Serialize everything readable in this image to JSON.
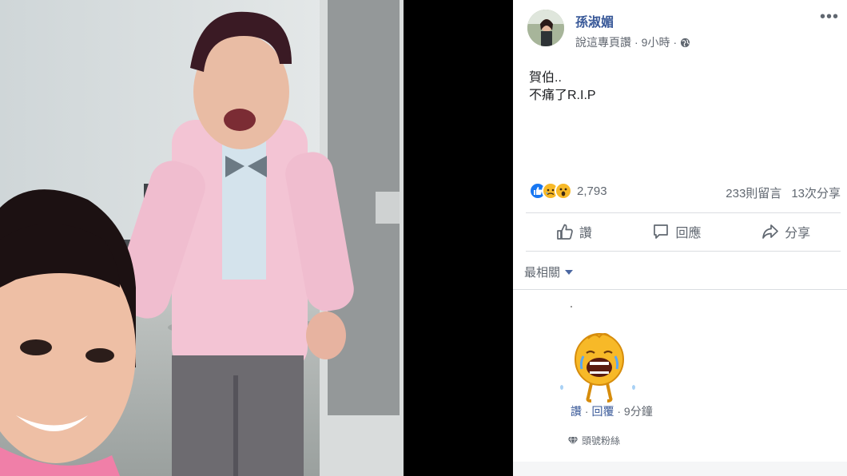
{
  "post": {
    "author": "孫淑媚",
    "meta_action": "說這專頁讚",
    "meta_dot1": "·",
    "meta_time": "9小時",
    "meta_dot2": "·",
    "more_label": "•••",
    "text_line1": "賀伯..",
    "text_line2": "不痛了R.I.P"
  },
  "reactions": {
    "types": [
      "like-icon",
      "sad-icon",
      "wow-icon"
    ],
    "count": "2,793",
    "comments_count": "233則留言",
    "shares_count": "13次分享"
  },
  "actions": {
    "like_label": "讚",
    "comment_label": "回應",
    "share_label": "分享"
  },
  "comments": {
    "sort_label": "最相關",
    "first_comment": {
      "sticker": "crying-emoji-sticker",
      "like_label": "讚",
      "dot1": "·",
      "reply_label": "回覆",
      "dot2": "·",
      "time": "9分鐘",
      "badge_label": "頭號粉絲"
    }
  },
  "colors": {
    "link_blue": "#385898",
    "gray_text": "#606770",
    "like_blue": "#1877f2",
    "emoji_yellow": "#f7b928"
  }
}
